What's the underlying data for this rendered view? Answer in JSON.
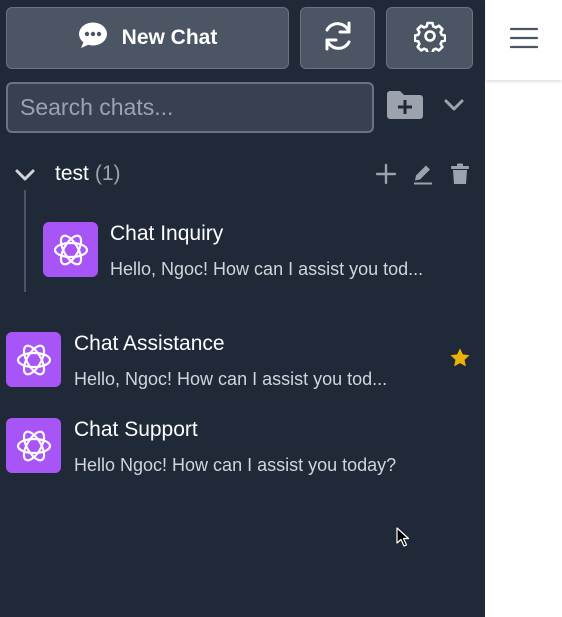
{
  "toolbar": {
    "new_chat_label": "New Chat"
  },
  "search": {
    "placeholder": "Search chats..."
  },
  "folder": {
    "name": "test",
    "count": "(1)",
    "chats": [
      {
        "title": "Chat Inquiry",
        "preview": "Hello, Ngoc! How can I assist you tod..."
      }
    ]
  },
  "chats": [
    {
      "title": "Chat Assistance",
      "preview": "Hello, Ngoc! How can I assist you tod...",
      "starred": true
    },
    {
      "title": "Chat Support",
      "preview": "Hello Ngoc! How can I assist you today?",
      "starred": false
    }
  ],
  "colors": {
    "sidebar_bg": "#1f2937",
    "avatar_bg": "#a855f7",
    "star": "#eab308"
  },
  "icons": [
    "chat-bubble-icon",
    "refresh-icon",
    "gear-icon",
    "new-folder-icon",
    "chevron-down-icon",
    "plus-icon",
    "pencil-icon",
    "trash-icon",
    "openai-logo-icon",
    "star-icon",
    "hamburger-menu-icon"
  ]
}
